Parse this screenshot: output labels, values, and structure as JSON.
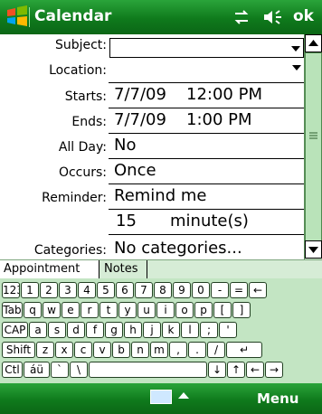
{
  "titlebar": {
    "title": "Calendar",
    "ok_label": "ok"
  },
  "form": {
    "subject": {
      "label": "Subject:",
      "value": ""
    },
    "location": {
      "label": "Location:",
      "value": ""
    },
    "starts": {
      "label": "Starts:",
      "date": "7/7/09",
      "time": "12:00 PM"
    },
    "ends": {
      "label": "Ends:",
      "date": "7/7/09",
      "time": "1:00 PM"
    },
    "allday": {
      "label": "All Day:",
      "value": "No"
    },
    "occurs": {
      "label": "Occurs:",
      "value": "Once"
    },
    "reminder": {
      "label": "Reminder:",
      "value": "Remind me",
      "amount": "15",
      "unit": "minute(s)"
    },
    "categories": {
      "label": "Categories:",
      "value": "No categories..."
    }
  },
  "tabs": [
    {
      "label": "Appointment"
    },
    {
      "label": "Notes"
    }
  ],
  "keyboard": {
    "row1": [
      "123",
      "1",
      "2",
      "3",
      "4",
      "5",
      "6",
      "7",
      "8",
      "9",
      "0",
      "-",
      "=",
      "←"
    ],
    "row2": [
      "Tab",
      "q",
      "w",
      "e",
      "r",
      "t",
      "y",
      "u",
      "i",
      "o",
      "p",
      "[",
      "]"
    ],
    "row3": [
      "CAP",
      "a",
      "s",
      "d",
      "f",
      "g",
      "h",
      "j",
      "k",
      "l",
      ";",
      "'"
    ],
    "row4": [
      "Shift",
      "z",
      "x",
      "c",
      "v",
      "b",
      "n",
      "m",
      ",",
      ".",
      "/",
      "↵"
    ],
    "row5": [
      "Ctl",
      "áü",
      "`",
      "\\",
      "",
      "↓",
      "↑",
      "←",
      "→"
    ]
  },
  "bottombar": {
    "menu_label": "Menu"
  },
  "colors": {
    "bar_green": "#0f7a1c",
    "keyboard_green": "#c3e5c3"
  }
}
